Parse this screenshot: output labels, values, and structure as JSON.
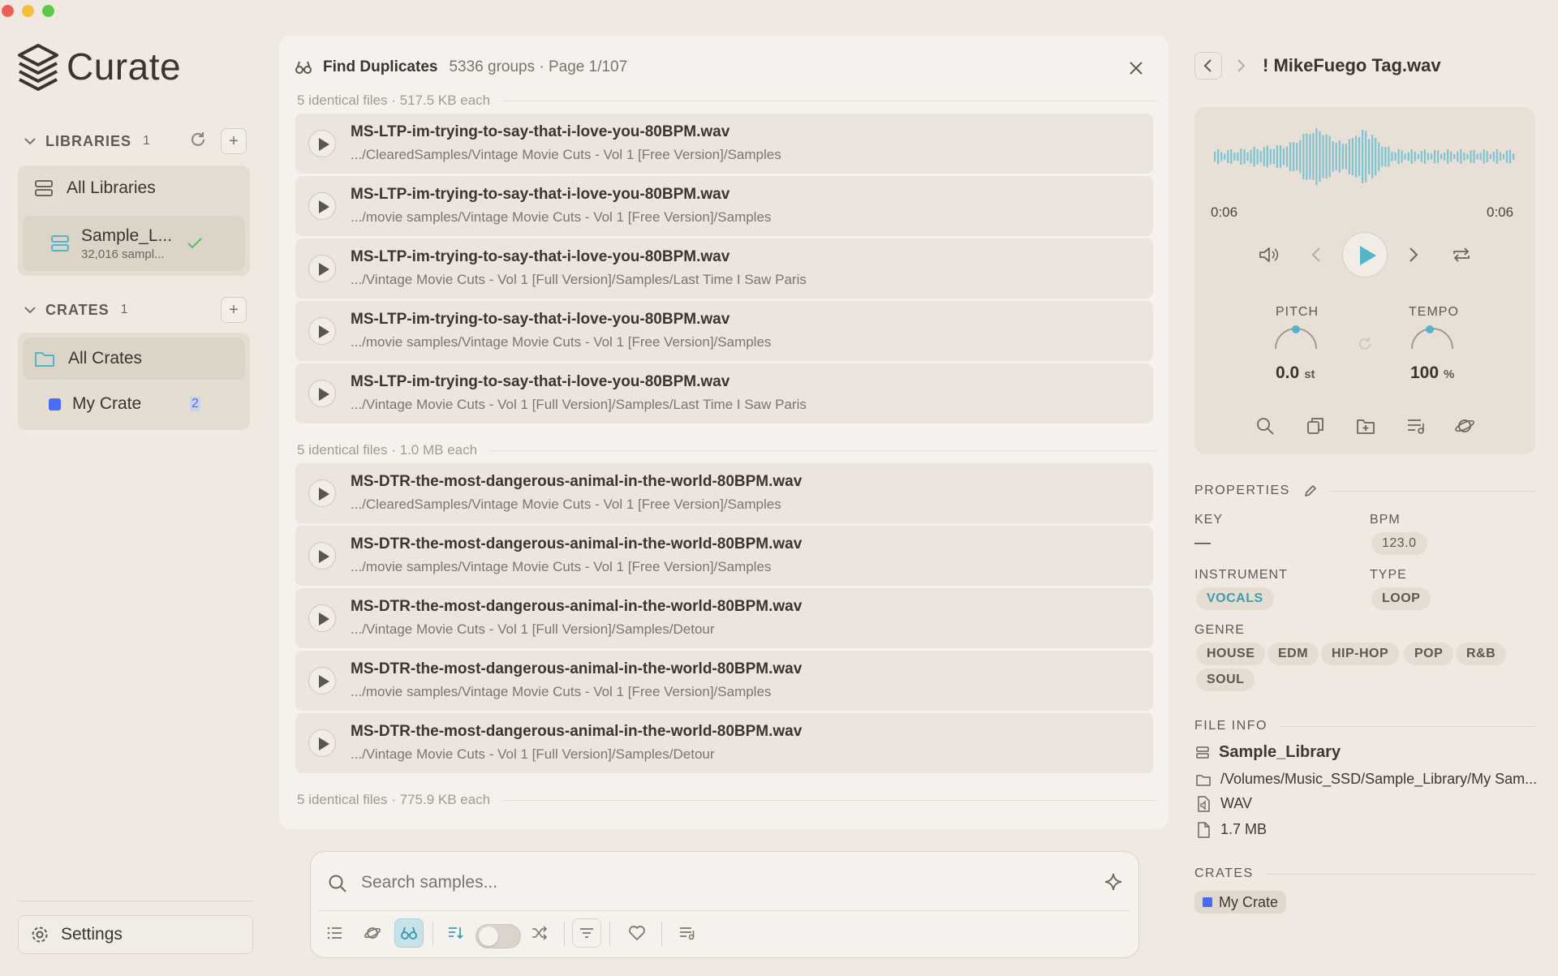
{
  "app": {
    "name": "Curate"
  },
  "sidebar": {
    "libraries": {
      "title": "LIBRARIES",
      "count": "1",
      "all_label": "All Libraries",
      "items": [
        {
          "name": "Sample_L...",
          "subtitle": "32,016 sampl..."
        }
      ]
    },
    "crates": {
      "title": "CRATES",
      "count": "1",
      "all_label": "All Crates",
      "items": [
        {
          "name": "My Crate",
          "count": "2",
          "color": "#4a6cf7"
        }
      ]
    },
    "settings_label": "Settings"
  },
  "duplicates": {
    "title": "Find Duplicates",
    "summary": "5336 groups · Page 1/107",
    "groups": [
      {
        "label": "5 identical files · 517.5 KB each",
        "files": [
          {
            "name": "MS-LTP-im-trying-to-say-that-i-love-you-80BPM.wav",
            "path": ".../ClearedSamples/Vintage Movie Cuts - Vol 1 [Free Version]/Samples"
          },
          {
            "name": "MS-LTP-im-trying-to-say-that-i-love-you-80BPM.wav",
            "path": ".../movie samples/Vintage Movie Cuts - Vol 1 [Free Version]/Samples"
          },
          {
            "name": "MS-LTP-im-trying-to-say-that-i-love-you-80BPM.wav",
            "path": ".../Vintage Movie Cuts - Vol 1 [Full Version]/Samples/Last Time I Saw Paris"
          },
          {
            "name": "MS-LTP-im-trying-to-say-that-i-love-you-80BPM.wav",
            "path": ".../movie samples/Vintage Movie Cuts - Vol 1 [Free Version]/Samples"
          },
          {
            "name": "MS-LTP-im-trying-to-say-that-i-love-you-80BPM.wav",
            "path": ".../Vintage Movie Cuts - Vol 1 [Full Version]/Samples/Last Time I Saw Paris"
          }
        ]
      },
      {
        "label": "5 identical files · 1.0 MB each",
        "files": [
          {
            "name": "MS-DTR-the-most-dangerous-animal-in-the-world-80BPM.wav",
            "path": ".../ClearedSamples/Vintage Movie Cuts - Vol 1 [Free Version]/Samples"
          },
          {
            "name": "MS-DTR-the-most-dangerous-animal-in-the-world-80BPM.wav",
            "path": ".../movie samples/Vintage Movie Cuts - Vol 1 [Free Version]/Samples"
          },
          {
            "name": "MS-DTR-the-most-dangerous-animal-in-the-world-80BPM.wav",
            "path": ".../Vintage Movie Cuts - Vol 1 [Full Version]/Samples/Detour"
          },
          {
            "name": "MS-DTR-the-most-dangerous-animal-in-the-world-80BPM.wav",
            "path": ".../movie samples/Vintage Movie Cuts - Vol 1 [Free Version]/Samples"
          },
          {
            "name": "MS-DTR-the-most-dangerous-animal-in-the-world-80BPM.wav",
            "path": ".../Vintage Movie Cuts - Vol 1 [Full Version]/Samples/Detour"
          }
        ]
      },
      {
        "label": "5 identical files · 775.9 KB each",
        "files": []
      }
    ]
  },
  "search": {
    "placeholder": "Search samples..."
  },
  "detail": {
    "title": "! MikeFuego Tag.wav",
    "time_current": "0:06",
    "time_total": "0:06",
    "pitch": {
      "label": "PITCH",
      "value": "0.0",
      "unit": "st"
    },
    "tempo": {
      "label": "TEMPO",
      "value": "100",
      "unit": "%"
    },
    "properties_title": "PROPERTIES",
    "key": {
      "label": "KEY",
      "value": "—"
    },
    "bpm": {
      "label": "BPM",
      "value": "123.0"
    },
    "instrument": {
      "label": "INSTRUMENT",
      "value": "VOCALS"
    },
    "type": {
      "label": "TYPE",
      "value": "LOOP"
    },
    "genre": {
      "label": "GENRE",
      "values": [
        "HOUSE",
        "EDM",
        "HIP-HOP",
        "POP",
        "R&B",
        "SOUL"
      ]
    },
    "file_info_title": "FILE INFO",
    "file_info": {
      "library": "Sample_Library",
      "path": "/Volumes/Music_SSD/Sample_Library/My Sam...",
      "format": "WAV",
      "size": "1.7 MB"
    },
    "crates_title": "CRATES",
    "crates": [
      {
        "name": "My Crate",
        "color": "#4a6cf7"
      }
    ]
  },
  "colors": {
    "accent": "#52b5c9",
    "background": "#efe9e2",
    "panel": "#f5f2ee"
  }
}
